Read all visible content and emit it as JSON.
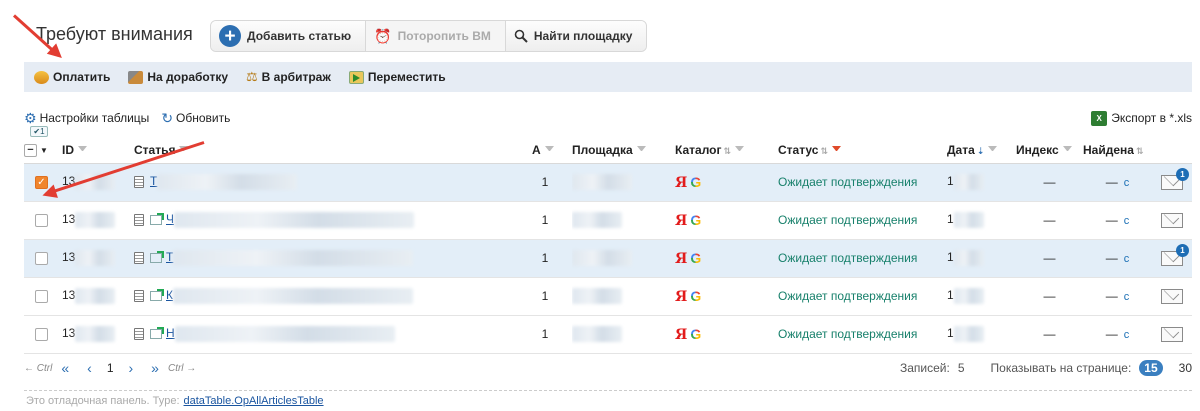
{
  "page_title": "Требуют внимания",
  "header_buttons": [
    {
      "label": "Добавить статью",
      "icon": "plus-icon",
      "enabled": true
    },
    {
      "label": "Поторопить ВМ",
      "icon": "alarm-clock-icon",
      "enabled": false
    },
    {
      "label": "Найти площадку",
      "icon": "search-icon",
      "enabled": true
    }
  ],
  "actions": {
    "pay": "Оплатить",
    "rework": "На доработку",
    "arbitrage": "В арбитраж",
    "move": "Переместить"
  },
  "tools": {
    "settings": "Настройки таблицы",
    "refresh": "Обновить",
    "export": "Экспорт в *.xls"
  },
  "mini_badge": "✔1",
  "columns": {
    "id": "ID",
    "article": "Статья",
    "a": "А",
    "site": "Площадка",
    "catalog": "Каталог",
    "status": "Статус",
    "date": "Дата",
    "index": "Индекс",
    "found": "Найдена"
  },
  "rows": [
    {
      "id": "13",
      "title": "Т",
      "a": "1",
      "ya": "Я",
      "g": "G",
      "status": "Ожидает подтверждения",
      "date": "1",
      "index": "—",
      "found": "—",
      "refresh": "c",
      "checked": true,
      "badge": "1"
    },
    {
      "id": "13",
      "title": "Ч",
      "a": "1",
      "ya": "Я",
      "g": "G",
      "status": "Ожидает подтверждения",
      "date": "1",
      "index": "—",
      "found": "—",
      "refresh": "c",
      "checked": false,
      "badge": ""
    },
    {
      "id": "13",
      "title": "Т",
      "a": "1",
      "ya": "Я",
      "g": "G",
      "status": "Ожидает подтверждения",
      "date": "1",
      "index": "—",
      "found": "—",
      "refresh": "c",
      "checked": false,
      "badge": "1"
    },
    {
      "id": "13",
      "title": "К",
      "a": "1",
      "ya": "Я",
      "g": "G",
      "status": "Ожидает подтверждения",
      "date": "1",
      "index": "—",
      "found": "—",
      "refresh": "c",
      "checked": false,
      "badge": ""
    },
    {
      "id": "13",
      "title": "Н",
      "a": "1",
      "ya": "Я",
      "g": "G",
      "status": "Ожидает подтверждения",
      "date": "1",
      "index": "—",
      "found": "—",
      "refresh": "c",
      "checked": false,
      "badge": ""
    }
  ],
  "pager": {
    "ctrl_left": "← Ctrl",
    "first": "«",
    "prev": "‹",
    "current": "1",
    "next": "›",
    "last": "»",
    "ctrl_right": "Ctrl →",
    "records_label": "Записей:",
    "records_count": "5",
    "per_page_label": "Показывать на странице:",
    "per_page_active": "15",
    "per_page_other": "30"
  },
  "debug": {
    "text": "Это отладочная панель. Type:",
    "link": "dataTable.OpAllArticlesTable"
  },
  "colors": {
    "accent": "#2c6eb1",
    "status": "#17806b",
    "highlight_row": "#e3eef8",
    "checkbox_on": "#f0852d",
    "arrow": "#e23d32"
  }
}
